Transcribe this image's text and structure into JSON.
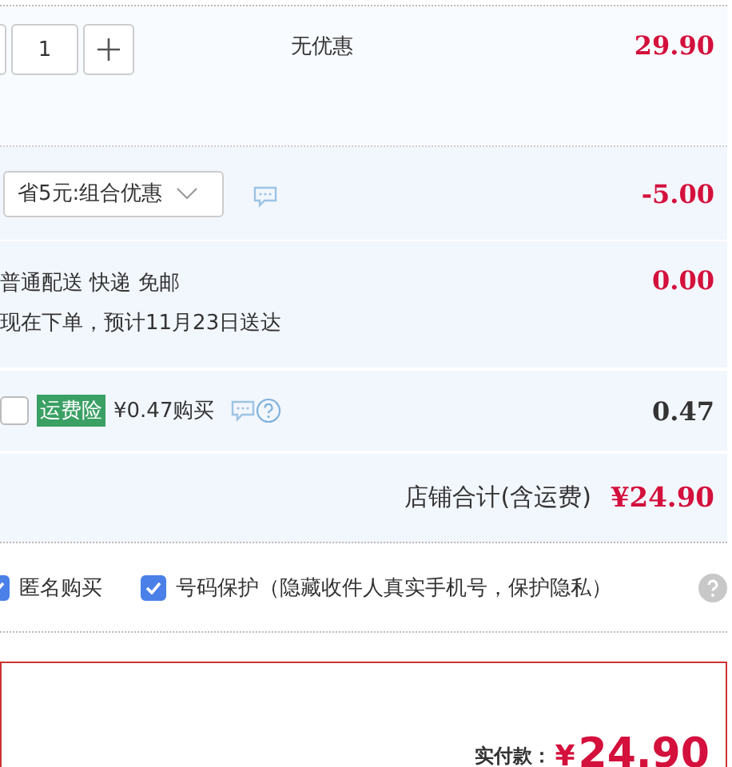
{
  "item": {
    "quantity": "1",
    "promotion": "无优惠",
    "price": "29.90"
  },
  "discount": {
    "label": "省5元:组合优惠",
    "amount": "-5.00"
  },
  "shipping": {
    "method": "普通配送 快递 免邮",
    "eta": "现在下单，预计11月23日送达",
    "fee": "0.00"
  },
  "insurance": {
    "checked": false,
    "badge": "运费险",
    "offer": "¥0.47购买",
    "amount": "0.47"
  },
  "shop_total": {
    "label": "店铺合计(含运费)",
    "amount": "¥24.90"
  },
  "options": [
    {
      "label": "匿名购买",
      "checked": true
    },
    {
      "label": "号码保护（隐藏收件人真实手机号，保护隐私）",
      "checked": true
    }
  ],
  "payment": {
    "label": "实付款：",
    "currency": "¥",
    "amount": "24.90"
  }
}
